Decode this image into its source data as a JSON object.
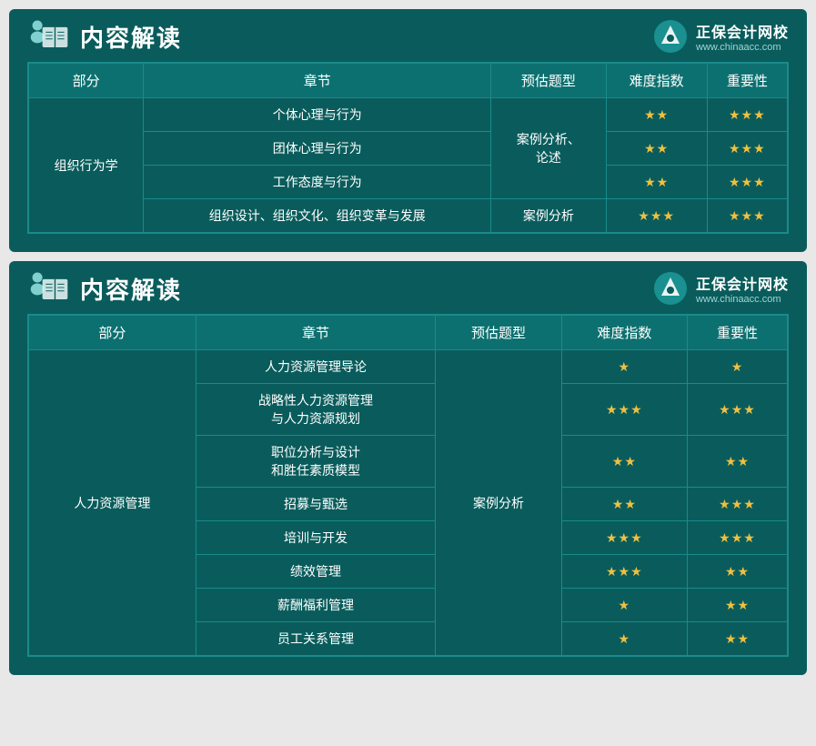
{
  "card1": {
    "title": "内容解读",
    "logo": {
      "name": "正保会计网校",
      "url": "www.chinaacc.com"
    },
    "table": {
      "headers": [
        "部分",
        "章节",
        "预估题型",
        "难度指数",
        "重要性"
      ],
      "rows": [
        {
          "part": "组织行为学",
          "chapters": [
            {
              "name": "个体心理与行为",
              "type": "案例分析、\n论述",
              "difficulty": "★★",
              "importance": "★★★"
            },
            {
              "name": "团体心理与行为",
              "type": "",
              "difficulty": "★★",
              "importance": "★★★"
            },
            {
              "name": "工作态度与行为",
              "type": "",
              "difficulty": "★★",
              "importance": "★★★"
            },
            {
              "name": "组织设计、组织文化、组织变革与发展",
              "type": "案例分析",
              "difficulty": "★★★",
              "importance": "★★★"
            }
          ]
        }
      ]
    }
  },
  "card2": {
    "title": "内容解读",
    "logo": {
      "name": "正保会计网校",
      "url": "www.chinaacc.com"
    },
    "table": {
      "headers": [
        "部分",
        "章节",
        "预估题型",
        "难度指数",
        "重要性"
      ],
      "rows": [
        {
          "part": "人力资源管理",
          "type": "案例分析",
          "chapters": [
            {
              "name": "人力资源管理导论",
              "difficulty": "★",
              "importance": "★"
            },
            {
              "name": "战略性人力资源管理\n与人力资源规划",
              "difficulty": "★★★",
              "importance": "★★★"
            },
            {
              "name": "职位分析与设计\n和胜任素质模型",
              "difficulty": "★★",
              "importance": "★★"
            },
            {
              "name": "招募与甄选",
              "difficulty": "★★",
              "importance": "★★★"
            },
            {
              "name": "培训与开发",
              "difficulty": "★★★",
              "importance": "★★★"
            },
            {
              "name": "绩效管理",
              "difficulty": "★★★",
              "importance": "★★"
            },
            {
              "name": "薪酬福利管理",
              "difficulty": "★",
              "importance": "★★"
            },
            {
              "name": "员工关系管理",
              "difficulty": "★",
              "importance": "★★"
            }
          ]
        }
      ]
    }
  }
}
